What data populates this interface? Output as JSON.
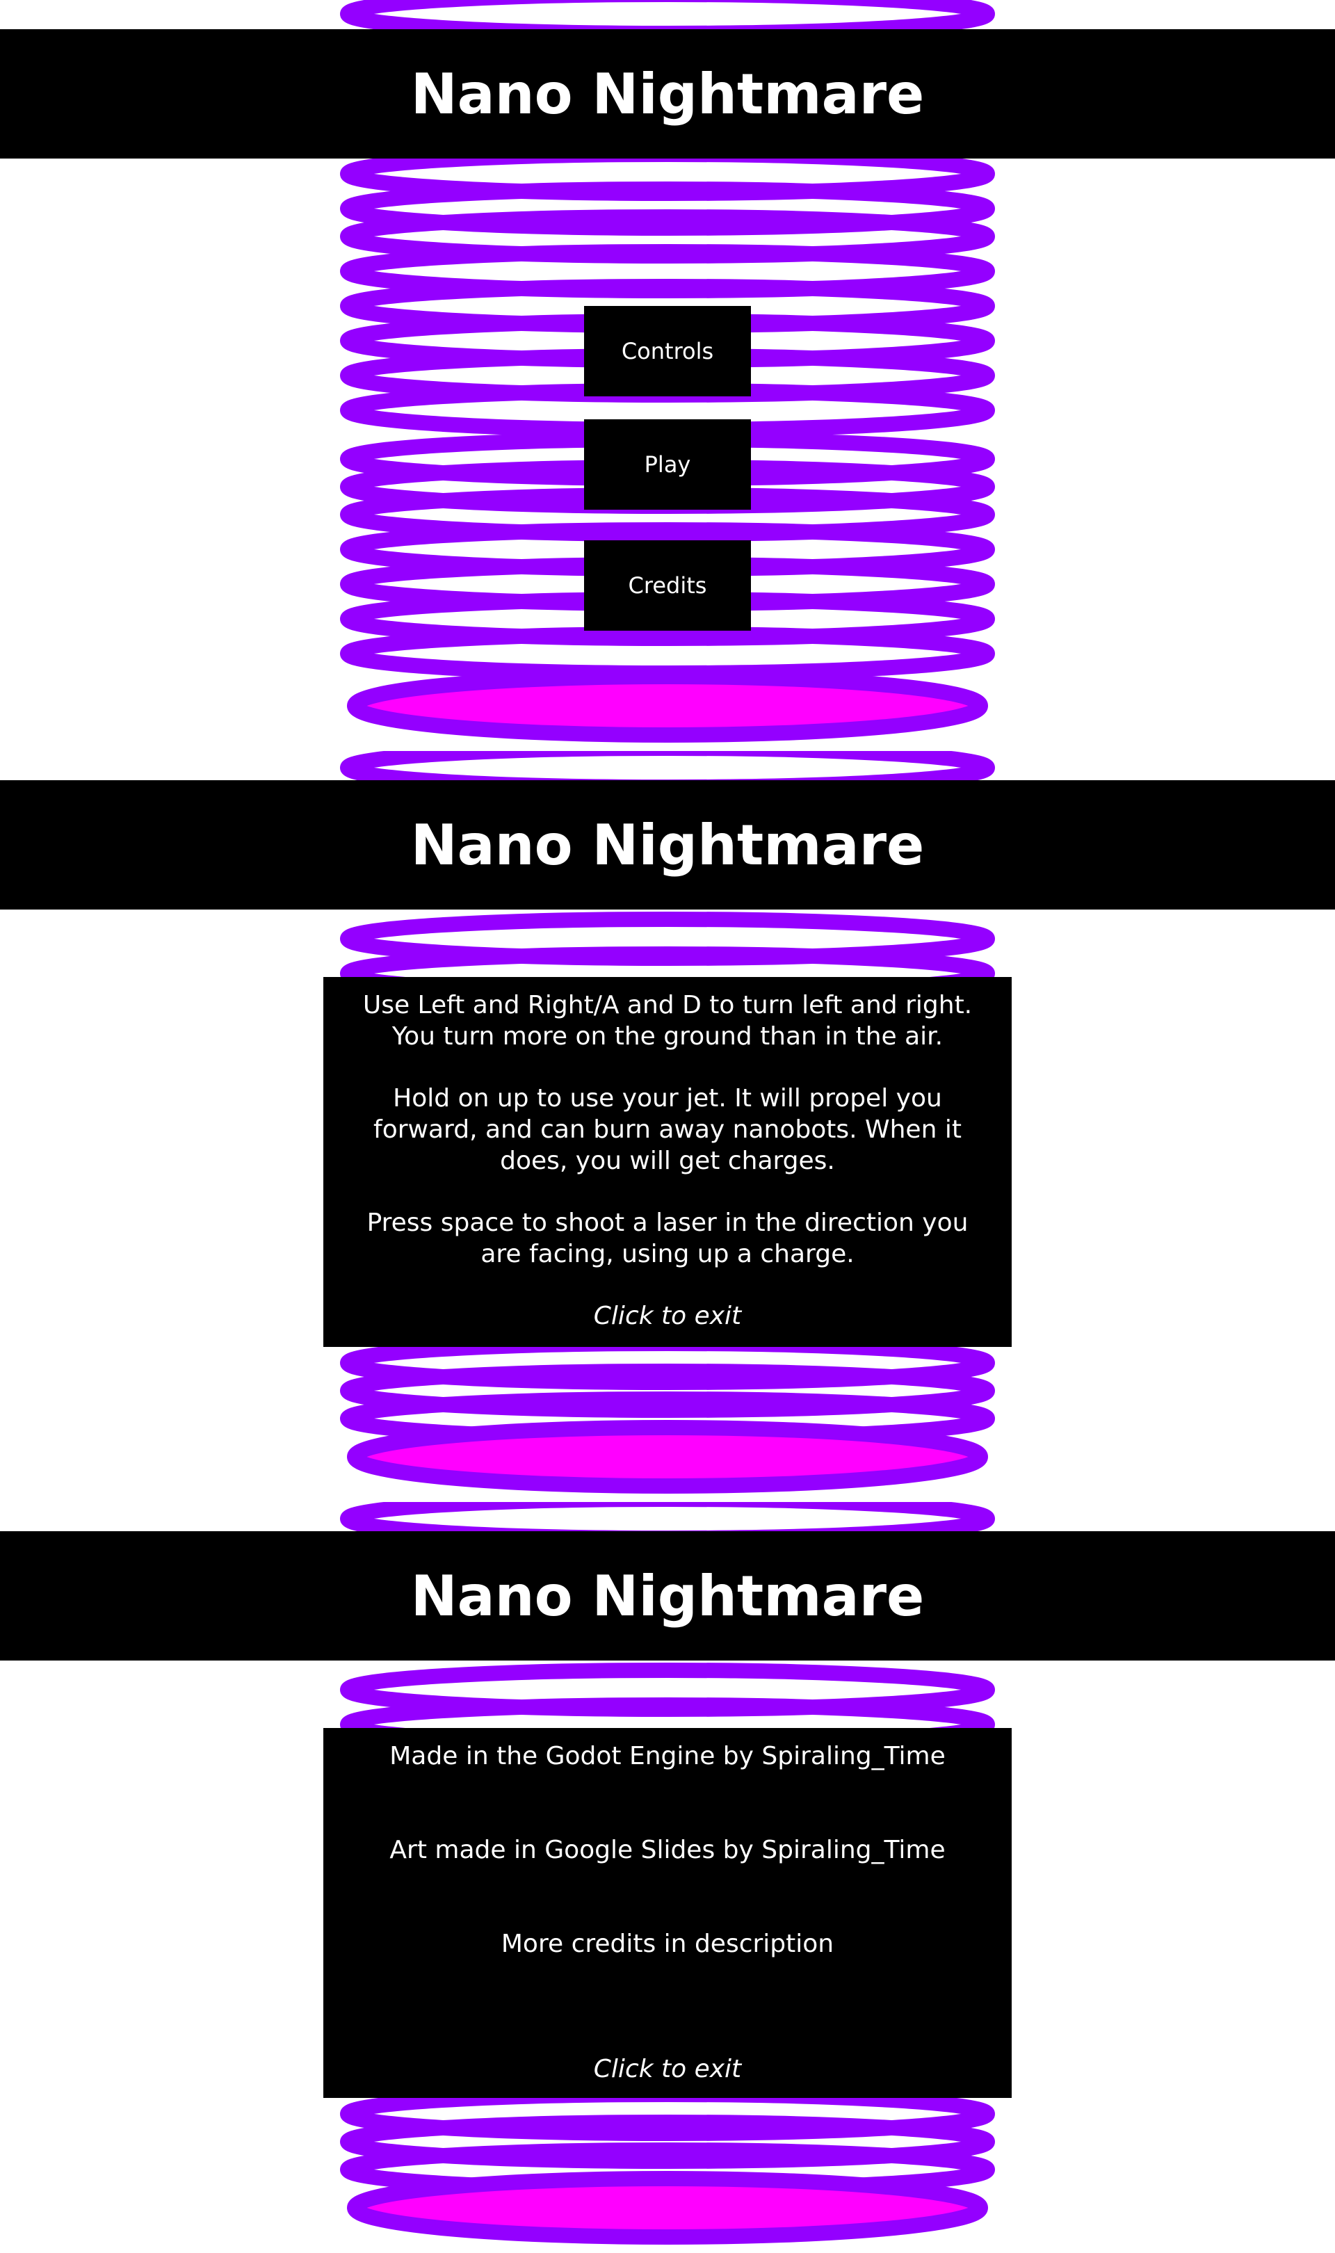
{
  "game": {
    "title": "Nano Nightmare",
    "colors": {
      "ring": "#9400FF",
      "ring_glow": "#FF00FF",
      "panel": "#000000",
      "text": "#FFFFFF",
      "background": "#FFFFFF"
    }
  },
  "menu": {
    "title": "Nano Nightmare",
    "buttons": {
      "controls": "Controls",
      "play": "Play",
      "credits": "Credits"
    }
  },
  "controls_screen": {
    "title": "Nano Nightmare",
    "paragraphs": [
      "Use Left and Right/A and D to turn left and right. You turn more on the ground than in the air.",
      "Hold on up to use your jet. It will propel you forward, and can burn away nanobots. When it does, you will get charges.",
      "Press space to shoot a laser in the direction you are facing, using up a charge."
    ],
    "exit": "Click to exit"
  },
  "credits_screen": {
    "title": "Nano Nightmare",
    "lines": [
      "Made in the Godot Engine by Spiraling_Time",
      "Art made in Google Slides by Spiraling_Time",
      "More credits in description"
    ],
    "exit": "Click to exit"
  }
}
